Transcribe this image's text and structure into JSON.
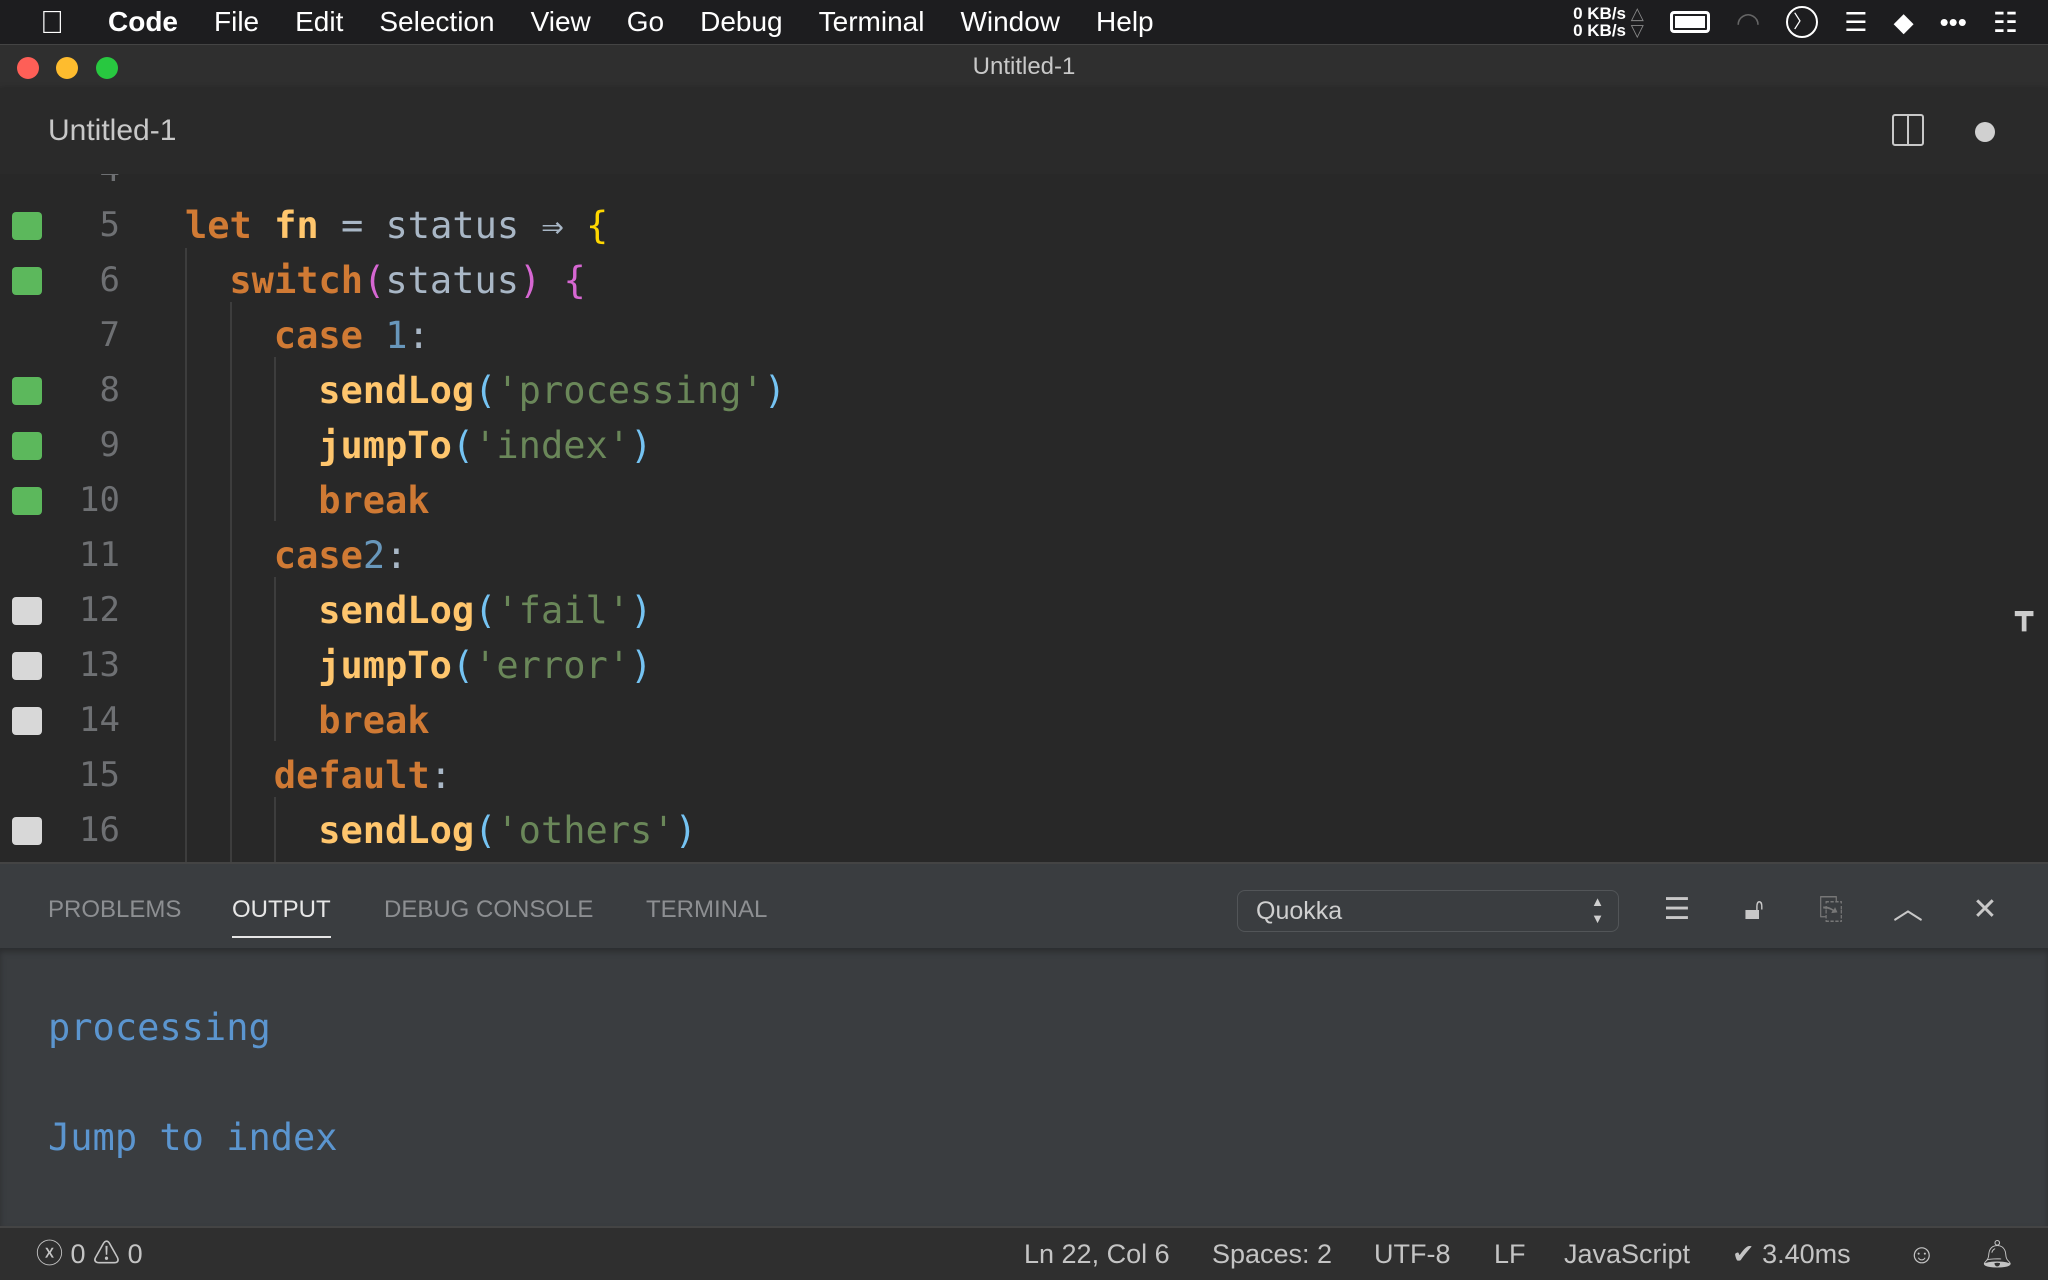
{
  "menubar": {
    "app": "Code",
    "items": [
      "File",
      "Edit",
      "Selection",
      "View",
      "Go",
      "Debug",
      "Terminal",
      "Window",
      "Help"
    ],
    "net_up": "0 KB/s",
    "net_down": "0 KB/s"
  },
  "window": {
    "title": "Untitled-1"
  },
  "tab": {
    "label": "Untitled-1"
  },
  "editor": {
    "lines": [
      {
        "num": "5",
        "cov": "covered"
      },
      {
        "num": "6",
        "cov": "covered"
      },
      {
        "num": "7",
        "cov": "none"
      },
      {
        "num": "8",
        "cov": "covered"
      },
      {
        "num": "9",
        "cov": "covered"
      },
      {
        "num": "10",
        "cov": "covered"
      },
      {
        "num": "11",
        "cov": "none"
      },
      {
        "num": "12",
        "cov": "uncovered"
      },
      {
        "num": "13",
        "cov": "uncovered"
      },
      {
        "num": "14",
        "cov": "uncovered"
      },
      {
        "num": "15",
        "cov": "none"
      },
      {
        "num": "16",
        "cov": "uncovered"
      }
    ],
    "tokens": {
      "l5": [
        "let",
        "fn",
        "=",
        "status",
        "⇒",
        "{"
      ],
      "l6": [
        "switch",
        "(",
        "status",
        ")",
        "{"
      ],
      "l7": [
        "case",
        "1",
        ":"
      ],
      "l8": [
        "sendLog",
        "(",
        "'processing'",
        ")"
      ],
      "l9": [
        "jumpTo",
        "(",
        "'index'",
        ")"
      ],
      "l10": [
        "break"
      ],
      "l11": [
        "case",
        "2",
        ":"
      ],
      "l12": [
        "sendLog",
        "(",
        "'fail'",
        ")"
      ],
      "l13": [
        "jumpTo",
        "(",
        "'error'",
        ")"
      ],
      "l14": [
        "break"
      ],
      "l15": [
        "default",
        ":"
      ],
      "l16": [
        "sendLog",
        "(",
        "'others'",
        ")"
      ]
    }
  },
  "colors": {
    "covered": "#5cb85c",
    "uncovered": "#d8d8d8",
    "none": "transparent"
  },
  "panel": {
    "tabs": [
      "PROBLEMS",
      "OUTPUT",
      "DEBUG CONSOLE",
      "TERMINAL"
    ],
    "active": "OUTPUT",
    "channel": "Quokka",
    "output": [
      "processing",
      "Jump to index"
    ]
  },
  "status": {
    "errors": "0",
    "warnings": "0",
    "position": "Ln 22, Col 6",
    "spaces": "Spaces: 2",
    "encoding": "UTF-8",
    "eol": "LF",
    "language": "JavaScript",
    "timing": "✔ 3.40ms"
  }
}
